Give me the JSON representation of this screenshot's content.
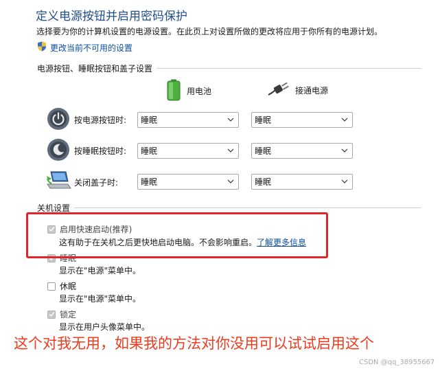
{
  "header": {
    "title": "定义电源按钮并启用密码保护",
    "description": "选择要为你的计算机设置的电源设置。在此页上对设置所做的更改将应用于你所有的电源计划。",
    "change_link": "更改当前不可用的设置"
  },
  "power_section": {
    "heading": "电源按钮、睡眠按钮和盖子设置",
    "columns": {
      "battery": "用电池",
      "plugged_in": "接通电源"
    },
    "rows": [
      {
        "label": "按电源按钮时:",
        "battery": "睡眠",
        "plugged_in": "睡眠",
        "icon": "power-button-icon"
      },
      {
        "label": "按睡眠按钮时:",
        "battery": "睡眠",
        "plugged_in": "睡眠",
        "icon": "sleep-button-icon"
      },
      {
        "label": "关闭盖子时:",
        "battery": "睡眠",
        "plugged_in": "睡眠",
        "icon": "laptop-lid-icon"
      }
    ]
  },
  "shutdown_section": {
    "heading": "关机设置",
    "options": [
      {
        "label": "启用快速启动(推荐)",
        "description": "这有助于在关机之后更快地启动电脑。不会影响重启。",
        "link": "了解更多信息",
        "checked": true
      },
      {
        "label": "睡眠",
        "description": "显示在\"电源\"菜单中。",
        "checked": true
      },
      {
        "label": "休眠",
        "description": "显示在\"电源\"菜单中。",
        "checked": false
      },
      {
        "label": "锁定",
        "description": "显示在用户头像菜单中。",
        "checked": true
      }
    ]
  },
  "annotation": "这个对我无用，如果我的方法对你没用可以试试启用这个",
  "watermark": "CSDN @qq_38955667",
  "colors": {
    "title": "#1f4e8c",
    "link": "#0b4ea2",
    "highlight": "#e0262a",
    "annotation": "#f03a1e"
  }
}
